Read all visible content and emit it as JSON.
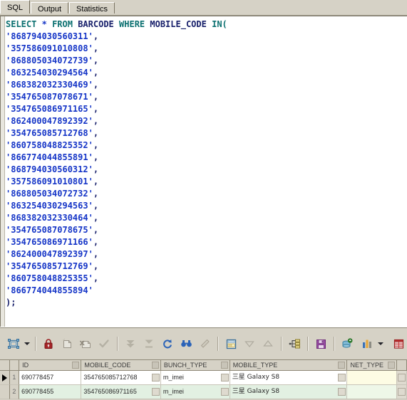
{
  "window": {
    "tabs": [
      {
        "label": "SQL",
        "active": true
      },
      {
        "label": "Output",
        "active": false
      },
      {
        "label": "Statistics",
        "active": false
      }
    ]
  },
  "editor": {
    "query_line_1": {
      "kw_select": "SELECT",
      "op_star": "*",
      "kw_from": "FROM",
      "table": "BARCODE",
      "kw_where": "WHERE",
      "column": "MOBILE_CODE",
      "kw_in": "IN("
    },
    "values": [
      "'868794030560311',",
      "'357586091010808',",
      "'868805034072739',",
      "'863254030294564',",
      "'868382032330469',",
      "'354765087078671',",
      "'354765086971165',",
      "'862400047892392',",
      "'354765085712768',",
      "'860758048825352',",
      "'866774044855891',",
      "'868794030560312',",
      "'357586091010801',",
      "'868805034072732',",
      "'863254030294563',",
      "'868382032330464',",
      "'354765087078675',",
      "'354765086971166',",
      "'862400047892397',",
      "'354765085712769',",
      "'860758048825355',",
      "'866774044855894'"
    ],
    "closing": ");",
    "colors": {
      "keyword": "#0b7070",
      "identifier": "#18206b",
      "string": "#1535c7",
      "background": "#ffffff"
    }
  },
  "toolbar": {
    "buttons": [
      {
        "name": "design-query-icon",
        "label": "Design Query"
      },
      {
        "name": "design-query-dropdown-icon",
        "label": "Design Query Options"
      },
      {
        "name": "lock-icon",
        "label": "Stop Current Query"
      },
      {
        "name": "new-record-icon",
        "label": "New Record"
      },
      {
        "name": "delete-record-icon",
        "label": "Delete Record"
      },
      {
        "name": "apply-changes-icon",
        "label": "Apply Changes"
      },
      {
        "name": "first-record-icon",
        "label": "First Record"
      },
      {
        "name": "last-record-icon",
        "label": "Last Record"
      },
      {
        "name": "refresh-icon",
        "label": "Refresh"
      },
      {
        "name": "find-icon",
        "label": "Find"
      },
      {
        "name": "clear-icon",
        "label": "Clear"
      },
      {
        "name": "form-view-icon",
        "label": "Form View"
      },
      {
        "name": "sort-desc-icon",
        "label": "Sort Descending"
      },
      {
        "name": "sort-asc-icon",
        "label": "Sort Ascending"
      },
      {
        "name": "filter-wizard-icon",
        "label": "Filter Wizard"
      },
      {
        "name": "save-icon",
        "label": "Save"
      },
      {
        "name": "export-database-icon",
        "label": "Export Wizard"
      },
      {
        "name": "chart-icon",
        "label": "Chart"
      },
      {
        "name": "chart-dropdown-icon",
        "label": "Chart Options"
      },
      {
        "name": "grid-icon",
        "label": "Grid View"
      },
      {
        "name": "grid-dropdown-icon",
        "label": "Grid Options"
      }
    ]
  },
  "grid": {
    "columns": [
      "ID",
      "MOBILE_CODE",
      "BUNCH_TYPE",
      "MOBILE_TYPE",
      "NET_TYPE"
    ],
    "rows": [
      {
        "num": "1",
        "selected": true,
        "ID": "690778457",
        "MOBILE_CODE": "354765085712768",
        "BUNCH_TYPE": "m_imei",
        "MOBILE_TYPE": "三星 Galaxy S8",
        "NET_TYPE": ""
      },
      {
        "num": "2",
        "selected": false,
        "ID": "690778455",
        "MOBILE_CODE": "354765086971165",
        "BUNCH_TYPE": "m_imei",
        "MOBILE_TYPE": "三星 Galaxy S8",
        "NET_TYPE": ""
      }
    ]
  }
}
